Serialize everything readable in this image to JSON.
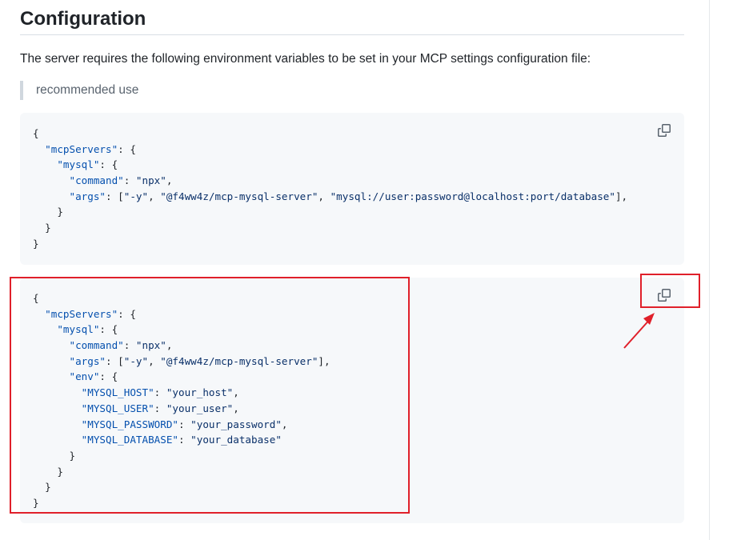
{
  "section": {
    "heading": "Configuration",
    "intro": "The server requires the following environment variables to be set in your MCP settings configuration file:",
    "blockquote": "recommended use"
  },
  "code_blocks": [
    {
      "lines": [
        "{",
        "  \"mcpServers\": {",
        "    \"mysql\": {",
        "      \"command\": \"npx\",",
        "      \"args\": [\"-y\", \"@f4ww4z/mcp-mysql-server\", \"mysql://user:password@localhost:port/database\"],",
        "    }",
        "  }",
        "}"
      ],
      "copy_icon": "copy-icon"
    },
    {
      "lines": [
        "{",
        "  \"mcpServers\": {",
        "    \"mysql\": {",
        "      \"command\": \"npx\",",
        "      \"args\": [\"-y\", \"@f4ww4z/mcp-mysql-server\"],",
        "      \"env\": {",
        "        \"MYSQL_HOST\": \"your_host\",",
        "        \"MYSQL_USER\": \"your_user\",",
        "        \"MYSQL_PASSWORD\": \"your_password\",",
        "        \"MYSQL_DATABASE\": \"your_database\"",
        "      }",
        "    }",
        "  }",
        "}"
      ],
      "copy_icon": "copy-icon"
    }
  ],
  "annotations": {
    "color": "#e0202a"
  }
}
